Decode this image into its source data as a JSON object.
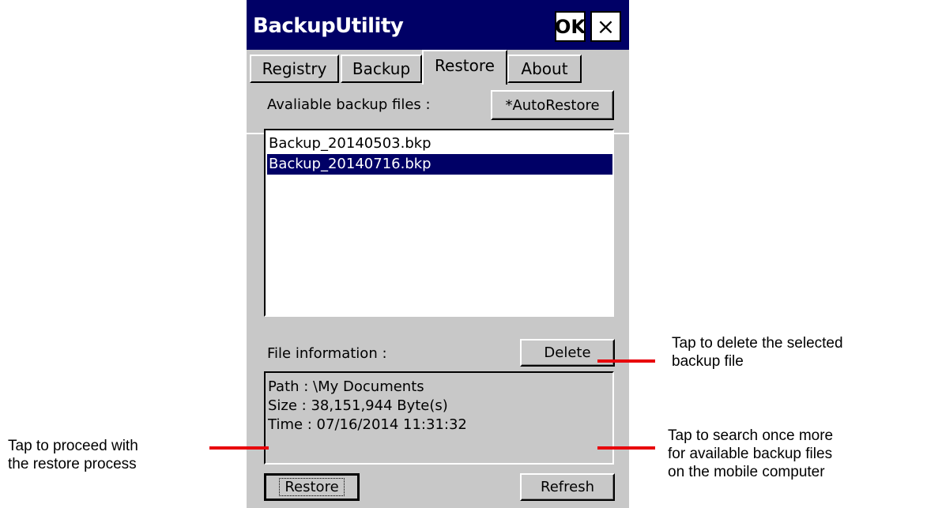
{
  "window": {
    "title": "BackupUtility",
    "ok_label": "OK",
    "close_label": "×"
  },
  "tabs": [
    {
      "label": "Registry"
    },
    {
      "label": "Backup"
    },
    {
      "label": "Restore",
      "active": true
    },
    {
      "label": "About"
    }
  ],
  "restore_panel": {
    "available_label": "Avaliable backup files :",
    "autorestore_label": "*AutoRestore",
    "files": [
      "Backup_20140503.bkp",
      "Backup_20140716.bkp"
    ],
    "selected_file": "Backup_20140716.bkp",
    "file_info_label": "File information :",
    "delete_label": "Delete",
    "info": {
      "path": "Path : \\My Documents",
      "size": "Size : 38,151,944 Byte(s)",
      "time": "Time : 07/16/2014 11:31:32"
    },
    "restore_label": "Restore",
    "refresh_label": "Refresh"
  },
  "annotations": {
    "delete": [
      "Tap to delete the selected",
      "backup file"
    ],
    "restore": [
      "Tap to proceed with",
      "the restore process"
    ],
    "refresh": [
      "Tap to search once more",
      "for available backup files",
      "on the mobile computer"
    ]
  },
  "colors": {
    "titlebar": "#000066",
    "selection": "#000066",
    "dialog_bg": "#c8c8c8",
    "callout_line": "#e8000b"
  }
}
